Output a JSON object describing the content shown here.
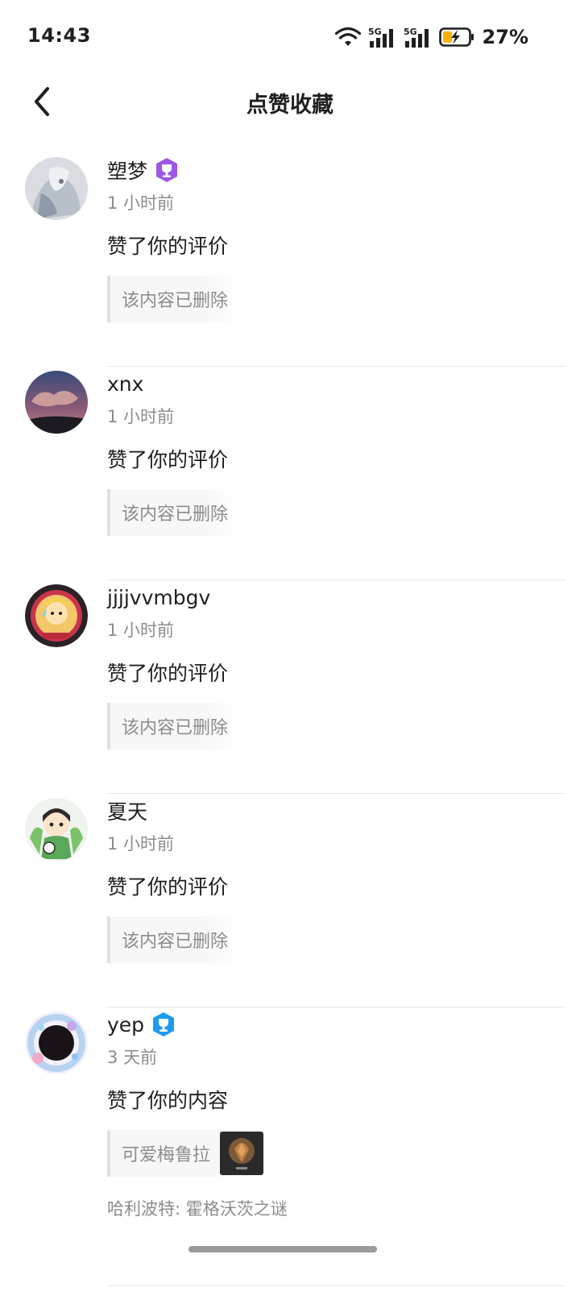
{
  "status_bar": {
    "time": "14:43",
    "network_label_1": "5G",
    "network_label_2": "5G",
    "battery_percent": "27%",
    "icons": [
      "wifi-icon",
      "signal-5g-icon",
      "signal-5g-icon",
      "battery-charging-icon"
    ]
  },
  "header": {
    "title": "点赞收藏",
    "back_icon": "chevron-left-icon"
  },
  "notifications": [
    {
      "name": "塑梦",
      "badge": "purple-trophy-badge",
      "time": "1 小时前",
      "action": "赞了你的评价",
      "quote": "该内容已删除"
    },
    {
      "name": "xnx",
      "badge": "",
      "time": "1 小时前",
      "action": "赞了你的评价",
      "quote": "该内容已删除"
    },
    {
      "name": "jjjjvvmbgv",
      "badge": "",
      "time": "1 小时前",
      "action": "赞了你的评价",
      "quote": "该内容已删除"
    },
    {
      "name": "夏天",
      "badge": "",
      "time": "1 小时前",
      "action": "赞了你的评价",
      "quote": "该内容已删除"
    },
    {
      "name": "yep",
      "badge": "blue-trophy-badge",
      "time": "3 天前",
      "action": "赞了你的内容",
      "quote": "可爱梅鲁拉",
      "source": "哈利波特: 霍格沃茨之谜"
    }
  ],
  "colors": {
    "text_primary": "#1f1f1f",
    "text_secondary": "#8c8c8c",
    "badge_purple": "#9b59e6",
    "badge_blue": "#1e9bef",
    "battery_fill": "#f5b301"
  }
}
